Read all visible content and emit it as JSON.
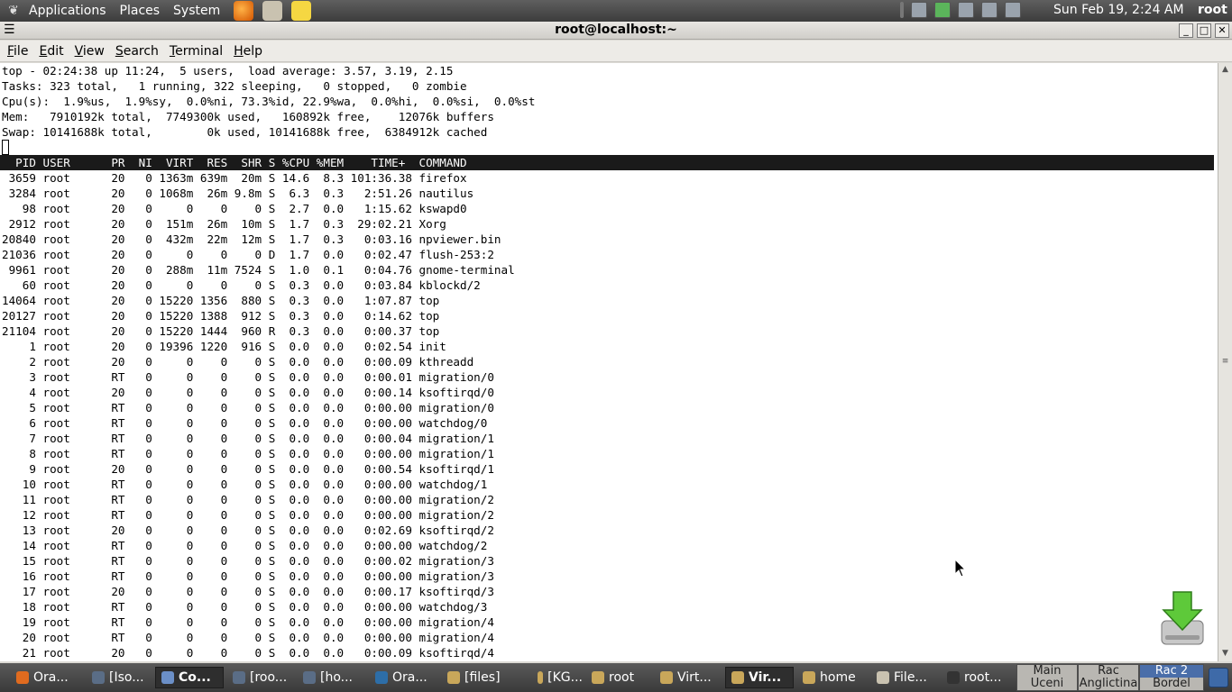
{
  "top_panel": {
    "menus": [
      "Applications",
      "Places",
      "System"
    ],
    "clock": "Sun Feb 19,  2:24 AM",
    "user": "root"
  },
  "window": {
    "title": "root@localhost:~",
    "menu": [
      "File",
      "Edit",
      "View",
      "Search",
      "Terminal",
      "Help"
    ]
  },
  "terminal": {
    "summary": [
      "top - 02:24:38 up 11:24,  5 users,  load average: 3.57, 3.19, 2.15",
      "Tasks: 323 total,   1 running, 322 sleeping,   0 stopped,   0 zombie",
      "Cpu(s):  1.9%us,  1.9%sy,  0.0%ni, 73.3%id, 22.9%wa,  0.0%hi,  0.0%si,  0.0%st",
      "Mem:   7910192k total,  7749300k used,   160892k free,    12076k buffers",
      "Swap: 10141688k total,        0k used, 10141688k free,  6384912k cached"
    ],
    "header": "  PID USER      PR  NI  VIRT  RES  SHR S %CPU %MEM    TIME+  COMMAND",
    "processes": [
      " 3659 root      20   0 1363m 639m  20m S 14.6  8.3 101:36.38 firefox",
      " 3284 root      20   0 1068m  26m 9.8m S  6.3  0.3   2:51.26 nautilus",
      "   98 root      20   0     0    0    0 S  2.7  0.0   1:15.62 kswapd0",
      " 2912 root      20   0  151m  26m  10m S  1.7  0.3  29:02.21 Xorg",
      "20840 root      20   0  432m  22m  12m S  1.7  0.3   0:03.16 npviewer.bin",
      "21036 root      20   0     0    0    0 D  1.7  0.0   0:02.47 flush-253:2",
      " 9961 root      20   0  288m  11m 7524 S  1.0  0.1   0:04.76 gnome-terminal",
      "   60 root      20   0     0    0    0 S  0.3  0.0   0:03.84 kblockd/2",
      "14064 root      20   0 15220 1356  880 S  0.3  0.0   1:07.87 top",
      "20127 root      20   0 15220 1388  912 S  0.3  0.0   0:14.62 top",
      "21104 root      20   0 15220 1444  960 R  0.3  0.0   0:00.37 top",
      "    1 root      20   0 19396 1220  916 S  0.0  0.0   0:02.54 init",
      "    2 root      20   0     0    0    0 S  0.0  0.0   0:00.09 kthreadd",
      "    3 root      RT   0     0    0    0 S  0.0  0.0   0:00.01 migration/0",
      "    4 root      20   0     0    0    0 S  0.0  0.0   0:00.14 ksoftirqd/0",
      "    5 root      RT   0     0    0    0 S  0.0  0.0   0:00.00 migration/0",
      "    6 root      RT   0     0    0    0 S  0.0  0.0   0:00.00 watchdog/0",
      "    7 root      RT   0     0    0    0 S  0.0  0.0   0:00.04 migration/1",
      "    8 root      RT   0     0    0    0 S  0.0  0.0   0:00.00 migration/1",
      "    9 root      20   0     0    0    0 S  0.0  0.0   0:00.54 ksoftirqd/1",
      "   10 root      RT   0     0    0    0 S  0.0  0.0   0:00.00 watchdog/1",
      "   11 root      RT   0     0    0    0 S  0.0  0.0   0:00.00 migration/2",
      "   12 root      RT   0     0    0    0 S  0.0  0.0   0:00.00 migration/2",
      "   13 root      20   0     0    0    0 S  0.0  0.0   0:02.69 ksoftirqd/2",
      "   14 root      RT   0     0    0    0 S  0.0  0.0   0:00.00 watchdog/2",
      "   15 root      RT   0     0    0    0 S  0.0  0.0   0:00.02 migration/3",
      "   16 root      RT   0     0    0    0 S  0.0  0.0   0:00.00 migration/3",
      "   17 root      20   0     0    0    0 S  0.0  0.0   0:00.17 ksoftirqd/3",
      "   18 root      RT   0     0    0    0 S  0.0  0.0   0:00.00 watchdog/3",
      "   19 root      RT   0     0    0    0 S  0.0  0.0   0:00.00 migration/4",
      "   20 root      RT   0     0    0    0 S  0.0  0.0   0:00.00 migration/4",
      "   21 root      20   0     0    0    0 S  0.0  0.0   0:00.09 ksoftirqd/4"
    ]
  },
  "taskbar": [
    {
      "label": "Ora...",
      "icon": "firefox-icon"
    },
    {
      "label": "[Iso...",
      "icon": "window-icon"
    },
    {
      "label": "Co...",
      "icon": "computer-icon",
      "active": true
    },
    {
      "label": "[roo...",
      "icon": "window-icon"
    },
    {
      "label": "[ho...",
      "icon": "window-icon"
    },
    {
      "label": "Ora...",
      "icon": "virtualbox-icon"
    },
    {
      "label": "[files]",
      "icon": "folder-icon"
    },
    {
      "label": "[KG...",
      "icon": "folder-icon"
    },
    {
      "label": "root",
      "icon": "folder-icon"
    },
    {
      "label": "Virt...",
      "icon": "folder-icon"
    },
    {
      "label": "Vir...",
      "icon": "folder-icon",
      "active": true
    },
    {
      "label": "home",
      "icon": "folder-icon"
    },
    {
      "label": "File...",
      "icon": "file-manager-icon"
    },
    {
      "label": "root...",
      "icon": "terminal-icon"
    }
  ],
  "workspaces": [
    {
      "top": "Main",
      "bottom": "Uceni"
    },
    {
      "top": "Rac",
      "bottom": "Anglictina"
    },
    {
      "top": "Rac 2",
      "bottom": "Bordel",
      "active": true
    }
  ],
  "colors": {
    "terminal_bg": "#ffffff",
    "header_bg": "#1a1a1a",
    "panel_bg": "#454545",
    "workspace_active": "#4a6ea9"
  }
}
